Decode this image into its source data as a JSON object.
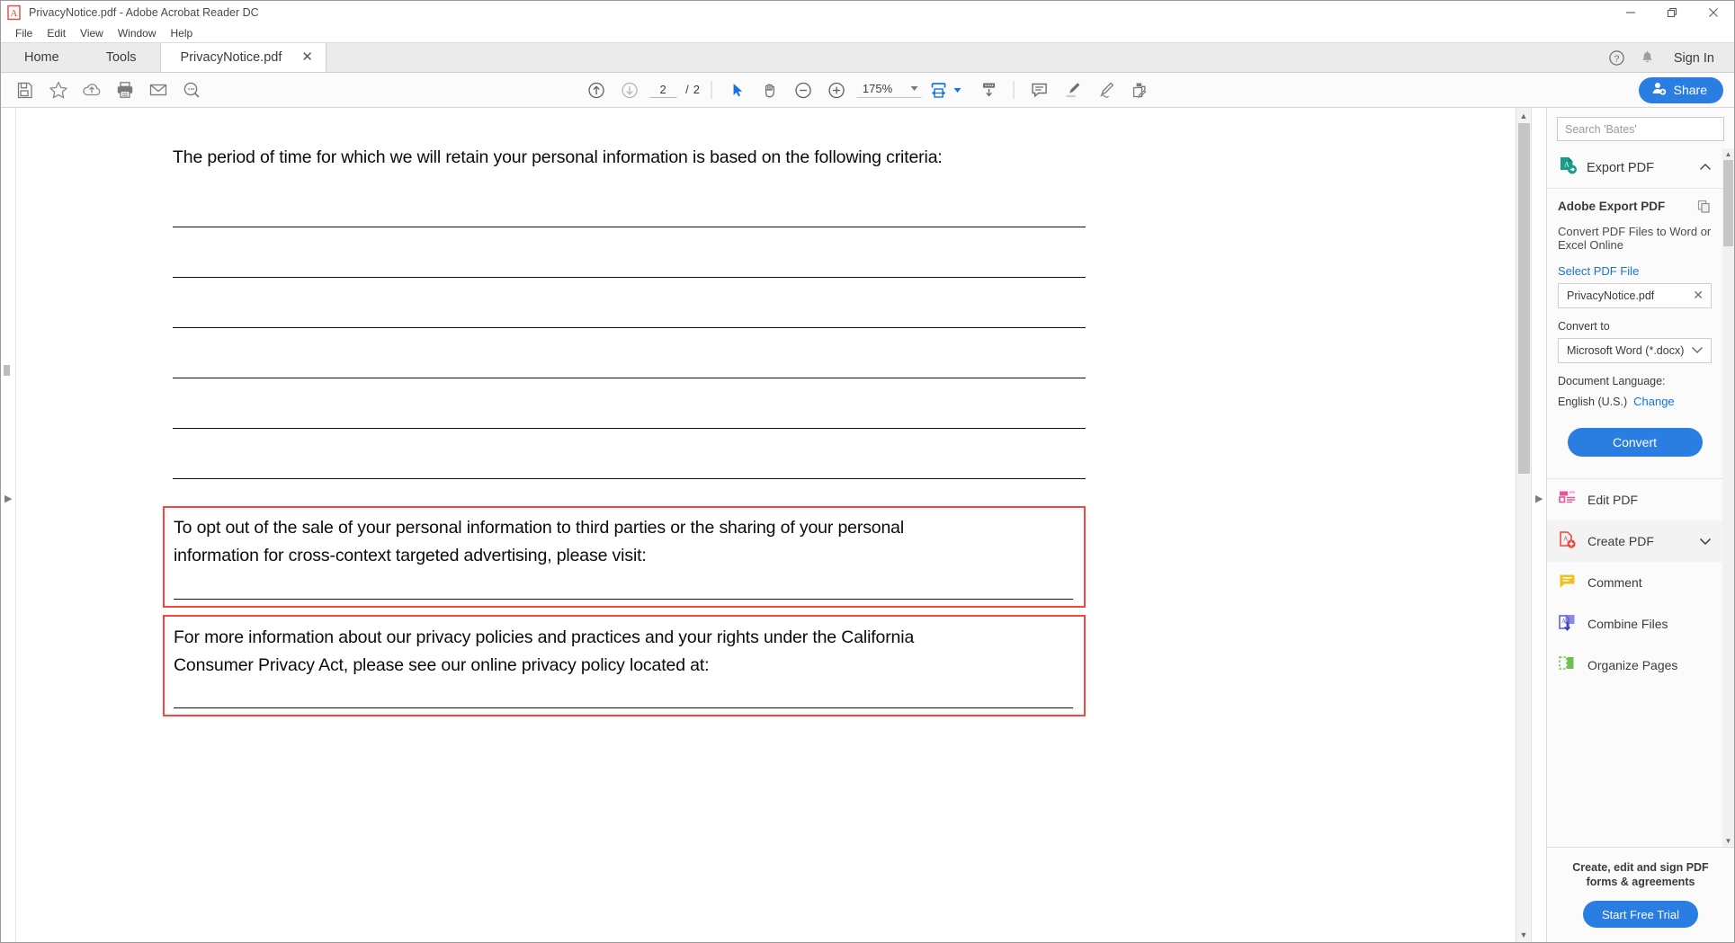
{
  "window": {
    "title": "PrivacyNotice.pdf - Adobe Acrobat Reader DC",
    "app_icon": "acrobat-logo-icon",
    "minimize": "–",
    "maximize": "❐",
    "close": "✕"
  },
  "menubar": {
    "items": [
      {
        "label": "File"
      },
      {
        "label": "Edit"
      },
      {
        "label": "View"
      },
      {
        "label": "Window"
      },
      {
        "label": "Help"
      }
    ]
  },
  "tabbar": {
    "home": "Home",
    "tools": "Tools",
    "document_tab": "PrivacyNotice.pdf",
    "close_glyph": "✕",
    "help_icon": "help-circle-icon",
    "bell_icon": "notification-bell-icon",
    "sign_in": "Sign In"
  },
  "toolbar": {
    "left_icons": [
      {
        "name": "save-file-icon"
      },
      {
        "name": "star-favorite-icon"
      },
      {
        "name": "cloud-upload-icon"
      },
      {
        "name": "print-icon"
      },
      {
        "name": "email-icon"
      },
      {
        "name": "search-zoom-icon"
      }
    ],
    "prev_page_icon": "previous-page-icon",
    "next_page_icon": "next-page-icon",
    "page_current": "2",
    "page_separator": "/",
    "page_total": "2",
    "select_tool_icon": "select-cursor-icon",
    "hand_tool_icon": "hand-pan-icon",
    "zoom_out_icon": "zoom-out-icon",
    "zoom_in_icon": "zoom-in-icon",
    "zoom_level": "175%",
    "fit_page_icon": "fit-page-width-icon",
    "scroll_mode_icon": "page-scroll-mode-icon",
    "comment_icon": "comment-balloon-icon",
    "highlight_icon": "highlight-marker-icon",
    "draw_icon": "draw-freehand-icon",
    "fill_sign_icon": "fill-and-sign-icon",
    "share_label": "Share",
    "share_icon": "share-person-add-icon"
  },
  "document": {
    "intro_line": "The period of time for which we will retain your personal information is based on the following criteria:",
    "blank_rules_count": 6,
    "boxes": [
      {
        "highlighted": true,
        "lines": [
          "To opt out of the sale of your personal information to third parties or the sharing of your personal",
          "information for cross-context targeted advertising, please visit:"
        ]
      },
      {
        "highlighted": true,
        "lines": [
          "For more information about our privacy policies and practices and your rights under the California",
          "Consumer Privacy Act, please see our online privacy policy located at:"
        ]
      }
    ],
    "highlight_color": "#f6463f"
  },
  "sidepanel": {
    "search_placeholder": "Search 'Bates'",
    "export": {
      "header_label": "Export PDF",
      "header_icon": "export-pdf-icon",
      "collapse_glyph": "⌃",
      "title": "Adobe Export PDF",
      "copy_icon": "copy-files-icon",
      "description": "Convert PDF Files to Word or Excel Online",
      "select_file_label": "Select PDF File",
      "selected_file": "PrivacyNotice.pdf",
      "clear_glyph": "✕",
      "convert_to_label": "Convert to",
      "convert_to_value": "Microsoft Word (*.docx)",
      "dropdown_glyph": "⌄",
      "language_label": "Document Language:",
      "language_value": "English (U.S.)",
      "language_change": "Change",
      "convert_button": "Convert"
    },
    "tools": [
      {
        "label": "Edit PDF",
        "icon": "edit-pdf-icon",
        "color": "#e2559b",
        "chevron": "",
        "highlighted": false
      },
      {
        "label": "Create PDF",
        "icon": "create-pdf-icon",
        "color": "#e8453c",
        "chevron": "⌄",
        "highlighted": true
      },
      {
        "label": "Comment",
        "icon": "comment-icon",
        "color": "#f0c020",
        "chevron": "",
        "highlighted": false
      },
      {
        "label": "Combine Files",
        "icon": "combine-files-icon",
        "color": "#5b5bd6",
        "chevron": "",
        "highlighted": false
      },
      {
        "label": "Organize Pages",
        "icon": "organize-pages-icon",
        "color": "#6cc24a",
        "chevron": "",
        "highlighted": false
      }
    ],
    "promo": {
      "line1": "Create, edit and sign PDF",
      "line2": "forms & agreements",
      "button": "Start Free Trial"
    }
  },
  "colors": {
    "accent_blue": "#2a7de1",
    "link_blue": "#1473e6",
    "highlight_red": "#f6463f"
  }
}
